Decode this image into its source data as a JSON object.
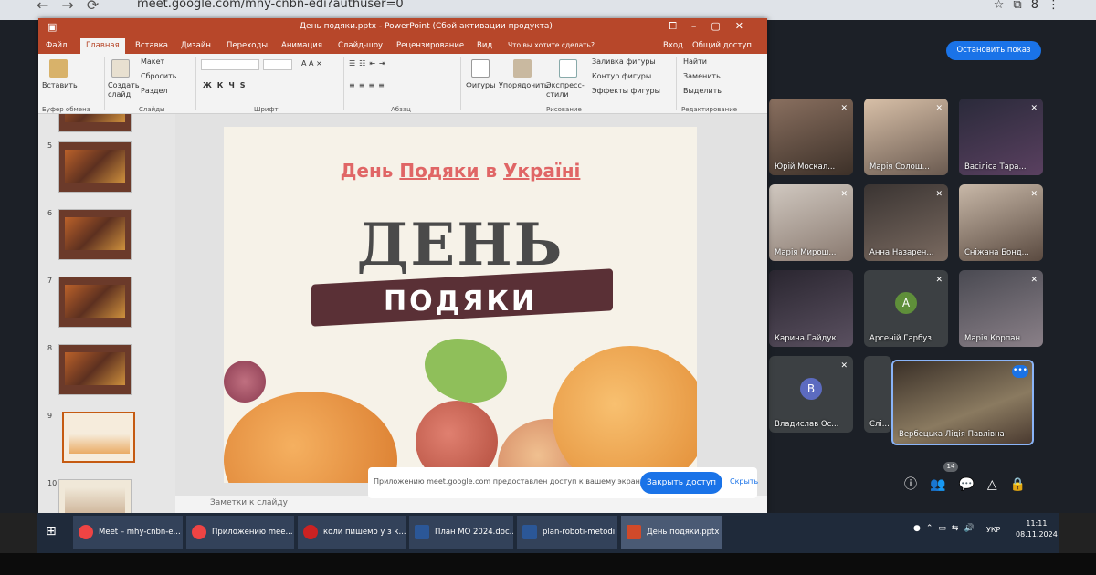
{
  "browser": {
    "url": "meet.google.com/mhy-cnbn-edi?authuser=0",
    "profile_initial": "8"
  },
  "meet": {
    "stop_presenting_label": "Остановить показ",
    "participant_count": "14",
    "participants": [
      {
        "name": "Юрій Москал..."
      },
      {
        "name": "Марія Солош..."
      },
      {
        "name": "Васіліса Тара..."
      },
      {
        "name": "Марія Мирош..."
      },
      {
        "name": "Анна Назарен..."
      },
      {
        "name": "Сніжана Бонд..."
      },
      {
        "name": "Карина Гайдук"
      },
      {
        "name": "Арсеній Гарбуз",
        "initial": "А"
      },
      {
        "name": "Марія Корпан"
      },
      {
        "name": "Владислав Ос...",
        "initial": "В"
      },
      {
        "name": "Єлі..."
      }
    ],
    "self_name": "Вербецька Лідія Павлівна"
  },
  "powerpoint": {
    "title": "День подяки.pptx - PowerPoint (Сбой активации продукта)",
    "tabs": [
      "Файл",
      "Главная",
      "Вставка",
      "Дизайн",
      "Переходы",
      "Анимация",
      "Слайд-шоу",
      "Рецензирование",
      "Вид",
      "Что вы хотите сделать?"
    ],
    "signin": "Вход",
    "share": "Общий доступ",
    "ribbon": {
      "paste": "Вставить",
      "clipboard": "Буфер обмена",
      "new_slide": "Создать слайд",
      "layout": "Макет",
      "reset": "Сбросить",
      "section": "Раздел",
      "slides_group": "Слайды",
      "font_group": "Шрифт",
      "paragraph_group": "Абзац",
      "shapes": "Фигуры",
      "arrange": "Упорядочить",
      "quick_styles": "Экспресс-стили",
      "fill": "Заливка фигуры",
      "outline": "Контур фигуры",
      "effects": "Эффекты фигуры",
      "drawing_group": "Рисование",
      "find": "Найти",
      "replace": "Заменить",
      "select": "Выделить",
      "editing_group": "Редактирование"
    },
    "slide_numbers": [
      "5",
      "6",
      "7",
      "8",
      "9",
      "10"
    ],
    "slide": {
      "title_part1": "День",
      "title_part2": "Подяки",
      "title_part3": "в",
      "title_part4": "Україні",
      "big_word": "ДЕНЬ",
      "ribbon_word": "ПОДЯКИ"
    },
    "notes_placeholder": "Заметки к слайду",
    "toast": {
      "message": "Приложению meet.google.com предоставлен доступ к вашему экрану.",
      "close_button": "Закрыть доступ",
      "hide": "Скрыть"
    }
  },
  "taskbar": {
    "items": [
      "Meet – mhy-cnbn-e...",
      "Приложению mee...",
      "коли пишемо у з к...",
      "План МО 2024.doc...",
      "plan-roboti-metodi...",
      "День подяки.pptx ..."
    ],
    "lang": "УКР",
    "time": "11:11",
    "date": "08.11.2024"
  }
}
